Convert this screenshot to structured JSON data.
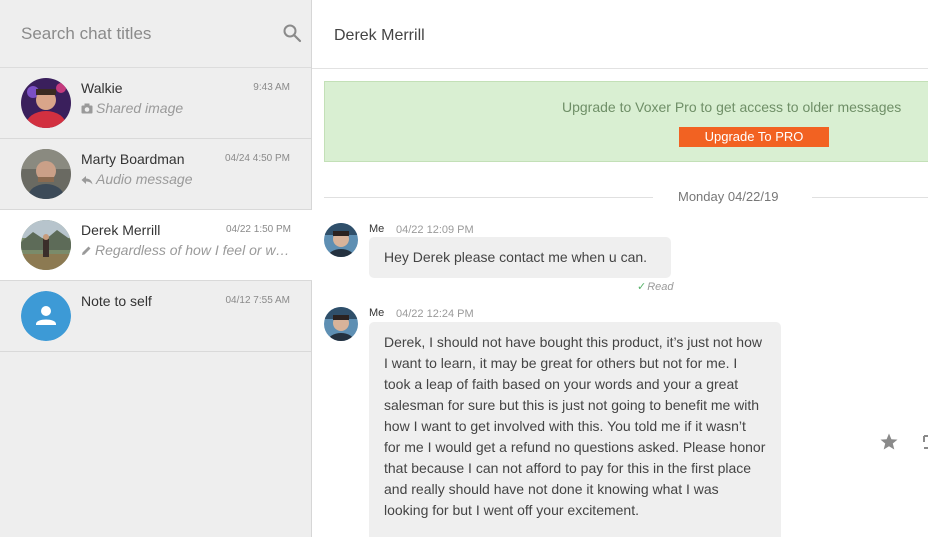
{
  "sidebar": {
    "search": {
      "placeholder": "Search chat titles",
      "value": ""
    },
    "chats": [
      {
        "title": "Walkie",
        "time": "9:43 AM",
        "preview": "Shared image",
        "preview_icon": "camera-icon"
      },
      {
        "title": "Marty Boardman",
        "time": "04/24 4:50 PM",
        "preview": "Audio message",
        "preview_icon": "reply-icon"
      },
      {
        "title": "Derek Merrill",
        "time": "04/22 1:50 PM",
        "preview": "Regardless of how I feel or wha...",
        "preview_icon": "pencil-icon",
        "active": true
      },
      {
        "title": "Note to self",
        "time": "04/12 7:55 AM",
        "preview": "",
        "preview_icon": "person-icon"
      }
    ]
  },
  "main": {
    "title": "Derek Merrill",
    "banner": {
      "text": "Upgrade to Voxer Pro to get access to older messages",
      "button": "Upgrade To PRO"
    },
    "date_divider": "Monday 04/22/19",
    "messages": [
      {
        "sender": "Me",
        "time": "04/22 12:09 PM",
        "text": "Hey Derek please contact me when u can.",
        "status": "Read"
      },
      {
        "sender": "Me",
        "time": "04/22 12:24 PM",
        "text": "Derek, I should not have bought this product, it’s just not how I want to learn, it may be great for others but not for me. I took a leap of faith based on your words and your a great salesman for sure but this is just not going to benefit me with how I want to get involved with this. You told me if it wasn’t for me I would get a refund no questions asked. Please honor that because I can not afford to pay for this in the first place and really should have not done it knowing what I was looking for but I went off your excitement."
      }
    ]
  },
  "colors": {
    "sidebar_bg": "#eeeeee",
    "banner_bg": "#d9efd2",
    "banner_text": "#6f8f67",
    "upgrade_button": "#f26222",
    "read_check": "#58b26a"
  }
}
